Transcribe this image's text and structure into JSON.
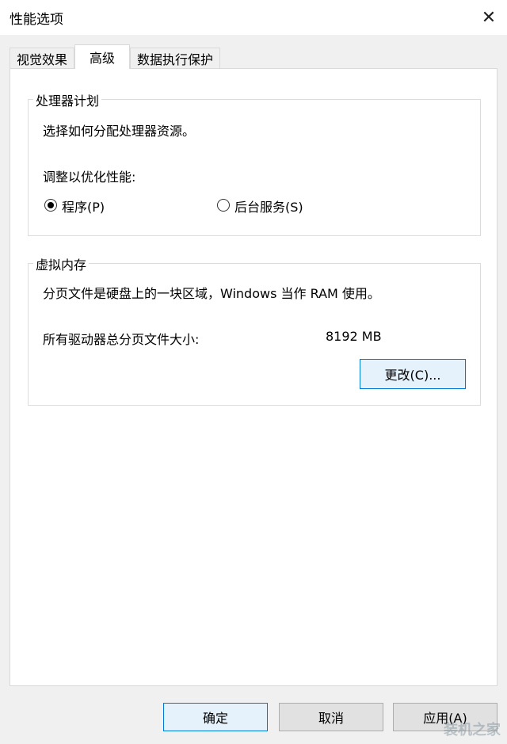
{
  "window": {
    "title": "性能选项",
    "close_glyph": "✕"
  },
  "tabs": [
    {
      "label": "视觉效果"
    },
    {
      "label": "高级"
    },
    {
      "label": "数据执行保护"
    }
  ],
  "processor_group": {
    "legend": "处理器计划",
    "description": "选择如何分配处理器资源。",
    "adjust_label": "调整以优化性能:",
    "options": [
      {
        "label": "程序(P)",
        "checked": true
      },
      {
        "label": "后台服务(S)",
        "checked": false
      }
    ]
  },
  "virtual_memory_group": {
    "legend": "虚拟内存",
    "description": "分页文件是硬盘上的一块区域，Windows 当作 RAM 使用。",
    "total_label": "所有驱动器总分页文件大小:",
    "total_value": "8192 MB",
    "change_button": "更改(C)..."
  },
  "footer": {
    "ok": "确定",
    "cancel": "取消",
    "apply": "应用(A)"
  },
  "watermark": "装机之家"
}
